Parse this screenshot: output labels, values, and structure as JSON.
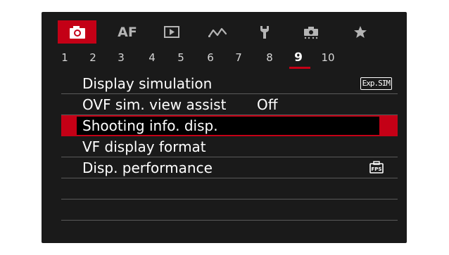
{
  "tabs": [
    {
      "name": "shooting",
      "icon": "camera-icon",
      "active": true
    },
    {
      "name": "af",
      "label": "AF",
      "active": false
    },
    {
      "name": "playback",
      "icon": "play-icon",
      "active": false
    },
    {
      "name": "wireless",
      "icon": "wireless-icon",
      "active": false
    },
    {
      "name": "setup",
      "icon": "wrench-icon",
      "active": false
    },
    {
      "name": "custom",
      "icon": "custom-functions-icon",
      "active": false
    },
    {
      "name": "my-menu",
      "icon": "star-icon",
      "active": false
    }
  ],
  "pages": [
    "1",
    "2",
    "3",
    "4",
    "5",
    "6",
    "7",
    "8",
    "9",
    "10"
  ],
  "active_page": "9",
  "menu": [
    {
      "label": "Display simulation",
      "badge": "Exp.SIM",
      "selected": false
    },
    {
      "label": "OVF sim. view assist",
      "value": "Off",
      "selected": false
    },
    {
      "label": "Shooting info. disp.",
      "selected": true
    },
    {
      "label": "VF display format",
      "selected": false
    },
    {
      "label": "Disp. performance",
      "badge_icon": "fps-icon",
      "selected": false
    }
  ],
  "colors": {
    "accent": "#c40016",
    "background": "#1a1a1a",
    "text": "#ffffff"
  }
}
